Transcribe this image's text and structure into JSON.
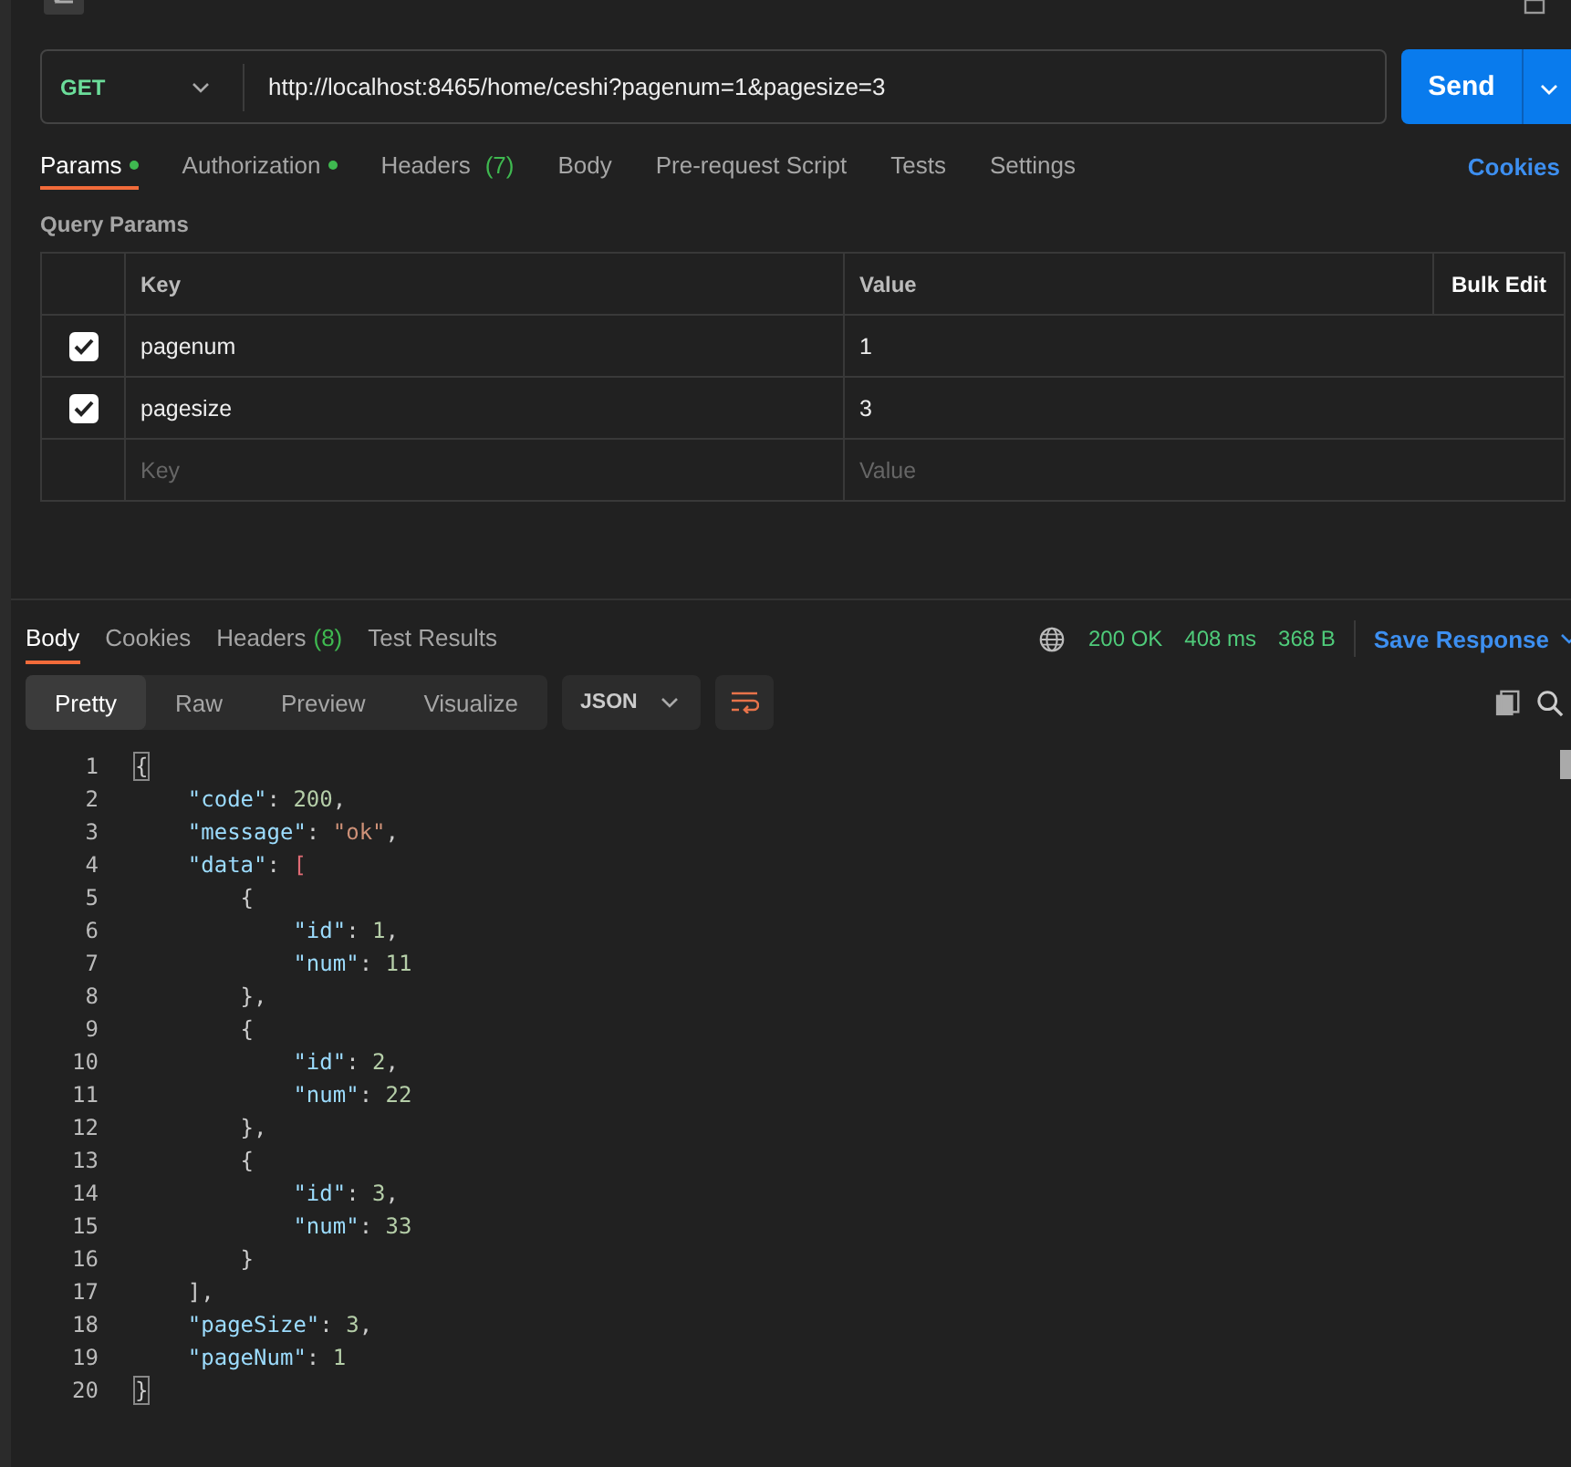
{
  "request": {
    "method": "GET",
    "url": "http://localhost:8465/home/ceshi?pagenum=1&pagesize=3",
    "send": "Send"
  },
  "request_tabs": [
    {
      "label": "Params",
      "dot": true,
      "selected": true
    },
    {
      "label": "Authorization",
      "dot": true,
      "selected": false
    },
    {
      "label": "Headers",
      "count": "(7)",
      "dot": false,
      "selected": false
    },
    {
      "label": "Body",
      "dot": false,
      "selected": false
    },
    {
      "label": "Pre-request Script",
      "dot": false,
      "selected": false
    },
    {
      "label": "Tests",
      "dot": false,
      "selected": false
    },
    {
      "label": "Settings",
      "dot": false,
      "selected": false
    }
  ],
  "cookies_link": "Cookies",
  "query_params": {
    "title": "Query Params",
    "columns": [
      "Key",
      "Value"
    ],
    "bulk_edit": "Bulk Edit",
    "rows": [
      {
        "checked": true,
        "key": "pagenum",
        "value": "1"
      },
      {
        "checked": true,
        "key": "pagesize",
        "value": "3"
      }
    ],
    "new_row": {
      "key_placeholder": "Key",
      "value_placeholder": "Value"
    }
  },
  "response_tabs": [
    {
      "label": "Body",
      "selected": true
    },
    {
      "label": "Cookies",
      "selected": false
    },
    {
      "label": "Headers",
      "count": "(8)",
      "selected": false
    },
    {
      "label": "Test Results",
      "selected": false
    }
  ],
  "status": {
    "code": "200 OK",
    "time": "408 ms",
    "size": "368 B",
    "save": "Save Response"
  },
  "view_modes": [
    {
      "label": "Pretty",
      "selected": true
    },
    {
      "label": "Raw",
      "selected": false
    },
    {
      "label": "Preview",
      "selected": false
    },
    {
      "label": "Visualize",
      "selected": false
    }
  ],
  "format": "JSON",
  "code_lines": [
    {
      "number": "1",
      "tokens": [
        {
          "kind": "punct",
          "text": "{",
          "matched": true
        }
      ]
    },
    {
      "number": "2",
      "tokens": [
        {
          "kind": "key",
          "text": "    \"code\""
        },
        {
          "kind": "punct",
          "text": ": "
        },
        {
          "kind": "number",
          "text": "200"
        },
        {
          "kind": "punct",
          "text": ","
        }
      ]
    },
    {
      "number": "3",
      "tokens": [
        {
          "kind": "key",
          "text": "    \"message\""
        },
        {
          "kind": "punct",
          "text": ": "
        },
        {
          "kind": "string",
          "text": "\"ok\""
        },
        {
          "kind": "punct",
          "text": ","
        }
      ]
    },
    {
      "number": "4",
      "tokens": [
        {
          "kind": "key",
          "text": "    \"data\""
        },
        {
          "kind": "punct",
          "text": ": "
        },
        {
          "kind": "bracket",
          "text": "["
        }
      ]
    },
    {
      "number": "5",
      "tokens": [
        {
          "kind": "punct",
          "text": "        {"
        }
      ]
    },
    {
      "number": "6",
      "tokens": [
        {
          "kind": "key",
          "text": "            \"id\""
        },
        {
          "kind": "punct",
          "text": ": "
        },
        {
          "kind": "number",
          "text": "1"
        },
        {
          "kind": "punct",
          "text": ","
        }
      ]
    },
    {
      "number": "7",
      "tokens": [
        {
          "kind": "key",
          "text": "            \"num\""
        },
        {
          "kind": "punct",
          "text": ": "
        },
        {
          "kind": "number",
          "text": "11"
        }
      ]
    },
    {
      "number": "8",
      "tokens": [
        {
          "kind": "punct",
          "text": "        },"
        }
      ]
    },
    {
      "number": "9",
      "tokens": [
        {
          "kind": "punct",
          "text": "        {"
        }
      ]
    },
    {
      "number": "10",
      "tokens": [
        {
          "kind": "key",
          "text": "            \"id\""
        },
        {
          "kind": "punct",
          "text": ": "
        },
        {
          "kind": "number",
          "text": "2"
        },
        {
          "kind": "punct",
          "text": ","
        }
      ]
    },
    {
      "number": "11",
      "tokens": [
        {
          "kind": "key",
          "text": "            \"num\""
        },
        {
          "kind": "punct",
          "text": ": "
        },
        {
          "kind": "number",
          "text": "22"
        }
      ]
    },
    {
      "number": "12",
      "tokens": [
        {
          "kind": "punct",
          "text": "        },"
        }
      ]
    },
    {
      "number": "13",
      "tokens": [
        {
          "kind": "punct",
          "text": "        {"
        }
      ]
    },
    {
      "number": "14",
      "tokens": [
        {
          "kind": "key",
          "text": "            \"id\""
        },
        {
          "kind": "punct",
          "text": ": "
        },
        {
          "kind": "number",
          "text": "3"
        },
        {
          "kind": "punct",
          "text": ","
        }
      ]
    },
    {
      "number": "15",
      "tokens": [
        {
          "kind": "key",
          "text": "            \"num\""
        },
        {
          "kind": "punct",
          "text": ": "
        },
        {
          "kind": "number",
          "text": "33"
        }
      ]
    },
    {
      "number": "16",
      "tokens": [
        {
          "kind": "punct",
          "text": "        }"
        }
      ]
    },
    {
      "number": "17",
      "tokens": [
        {
          "kind": "punct",
          "text": "    ],"
        }
      ]
    },
    {
      "number": "18",
      "tokens": [
        {
          "kind": "key",
          "text": "    \"pageSize\""
        },
        {
          "kind": "punct",
          "text": ": "
        },
        {
          "kind": "number",
          "text": "3"
        },
        {
          "kind": "punct",
          "text": ","
        }
      ]
    },
    {
      "number": "19",
      "tokens": [
        {
          "kind": "key",
          "text": "    \"pageNum\""
        },
        {
          "kind": "punct",
          "text": ": "
        },
        {
          "kind": "number",
          "text": "1"
        }
      ]
    },
    {
      "number": "20",
      "tokens": [
        {
          "kind": "punct",
          "text": "}",
          "matched": true
        }
      ]
    }
  ]
}
